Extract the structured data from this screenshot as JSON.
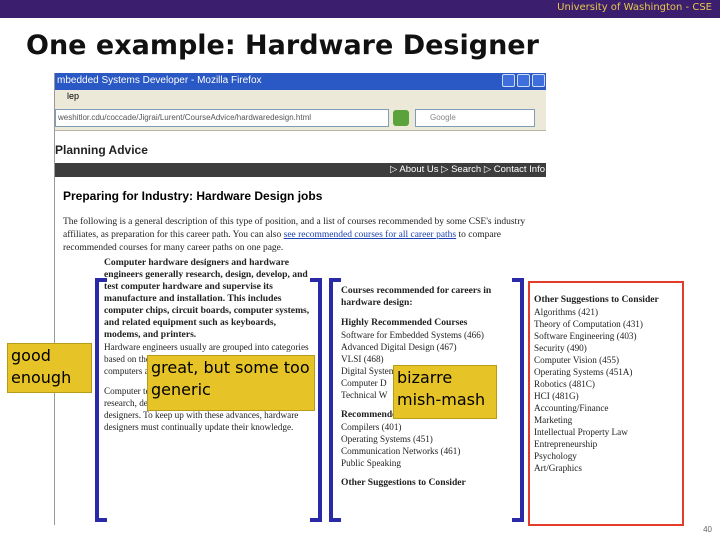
{
  "header": {
    "university": "University of Washington - CSE"
  },
  "slide": {
    "title": "One example: Hardware Designer",
    "page_number": "40"
  },
  "browser": {
    "window_title": "mbedded Systems Developer - Mozilla Firefox",
    "menu_text": "lep",
    "url": "weshitlor.cdu/coccade/Jigrai/Lurent/CourseAdvice/hardwaredesign.html",
    "search_placeholder": "Google",
    "page_heading": "Planning Advice",
    "nav_links": "▷ About Us  ▷ Search  ▷ Contact Info",
    "doc_title": "Preparing for Industry: Hardware Design jobs",
    "intro_text": "The following is a general description of this type of position, and a list of courses recommended by some CSE's industry affiliates, as preparation for this career path. You can also",
    "intro_link": "see recommended courses for all career paths",
    "intro_tail": "to compare recommended courses for many career paths on one page."
  },
  "col1": {
    "para1": "Computer hardware designers and hardware engineers generally research, design, develop, and test computer hardware and supervise its manufacture and installation. This includes computer chips, circuit boards, computer systems, and related equipment such as keyboards, modems, and printers.",
    "para1_cont": "Hardware engineers usually are grouped into categories based on their focus, and often work exclusively with computers and computer-related equipment.",
    "para2": "Computer technology advances largely result from research, development, and design efforts of hardware designers. To keep up with these advances, hardware designers must continually update their knowledge."
  },
  "col2": {
    "heading": "Courses recommended for careers in hardware design:",
    "highly_heading": "Highly Recommended Courses",
    "highly_items": [
      "Software for Embedded Systems (466)",
      "Advanced Digital Design (467)",
      "VLSI (468)",
      "Digital Systems",
      "Computer D",
      "Technical W"
    ],
    "recommended_heading": "Recommended Courses",
    "recommended_items": [
      "Compilers (401)",
      "Operating Systems (451)",
      "Communication Networks (461)",
      "Public Speaking"
    ],
    "other_heading": "Other Suggestions to Consider"
  },
  "col3": {
    "heading": "Other Suggestions to Consider",
    "items": [
      "Algorithms (421)",
      "Theory of Computation (431)",
      "Software Engineering (403)",
      "Security (490)",
      "Computer Vision (455)",
      "Operating Systems (451A)",
      "Robotics (481C)",
      "HCI (481G)",
      "Accounting/Finance",
      "Marketing",
      "Intellectual Property Law",
      "Entrepreneurship",
      "Psychology",
      "Art/Graphics"
    ]
  },
  "callouts": {
    "c1": "good enough",
    "c2": "great, but some too generic",
    "c3": "bizarre mish-mash"
  },
  "colors": {
    "bracket": "#2a2aa8",
    "callout": "#e6c427",
    "highlight_box": "#e23c2a",
    "top_bar": "#3b1f6e"
  }
}
